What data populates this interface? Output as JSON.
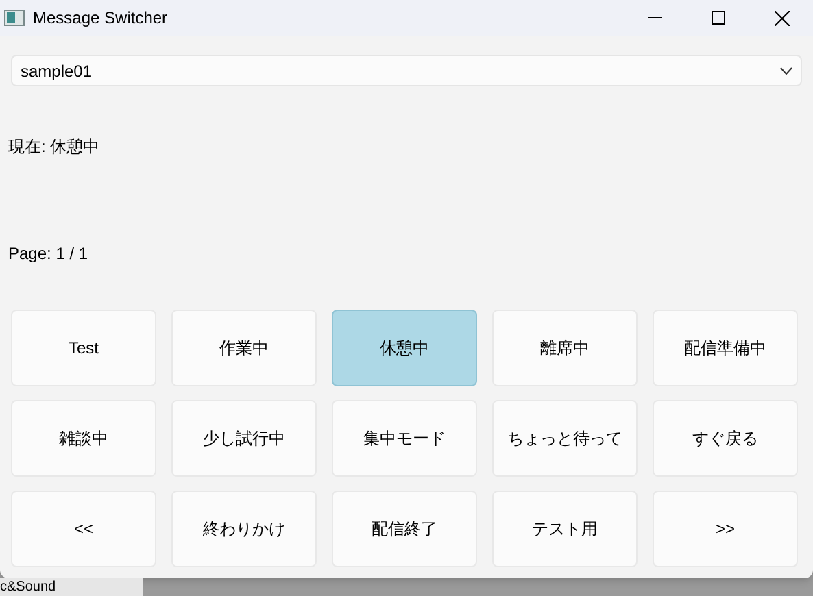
{
  "window": {
    "title": "Message Switcher"
  },
  "profile_select": {
    "value": "sample01"
  },
  "status": "現在: 休憩中",
  "page": "Page: 1 / 1",
  "buttons": [
    {
      "label": "Test",
      "selected": false
    },
    {
      "label": "作業中",
      "selected": false
    },
    {
      "label": "休憩中",
      "selected": true
    },
    {
      "label": "離席中",
      "selected": false
    },
    {
      "label": "配信準備中",
      "selected": false
    },
    {
      "label": "雑談中",
      "selected": false
    },
    {
      "label": "少し試行中",
      "selected": false
    },
    {
      "label": "集中モード",
      "selected": false
    },
    {
      "label": "ちょっと待って",
      "selected": false
    },
    {
      "label": "すぐ戻る",
      "selected": false
    },
    {
      "label": "<<",
      "selected": false
    },
    {
      "label": "終わりかけ",
      "selected": false
    },
    {
      "label": "配信終了",
      "selected": false
    },
    {
      "label": "テスト用",
      "selected": false
    },
    {
      "label": ">>",
      "selected": false
    }
  ],
  "background_window": {
    "text": "c&Sound"
  }
}
